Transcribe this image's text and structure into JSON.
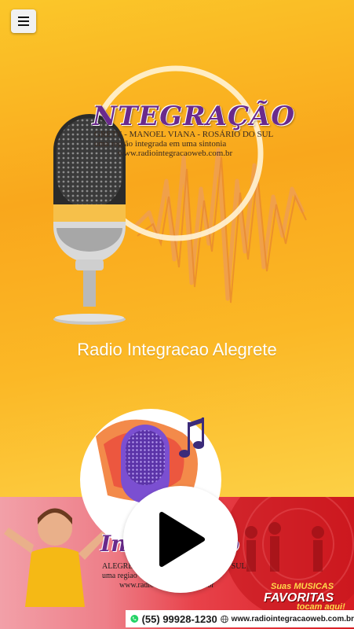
{
  "header": {
    "menu_icon": "hamburger-menu-icon"
  },
  "hero_logo": {
    "title": "NTEGRAÇÃO",
    "line1": "GRETE - MANOEL VIANA - ROSÁRIO DO SUL",
    "line2": "uma região integrada em uma sintonia",
    "line3": "www.radiointegracaoweb.com.br"
  },
  "station": {
    "name": "Radio Integracao Alegrete"
  },
  "banner": {
    "logo_title": "Int",
    "logo_title_end": "o",
    "line1": "ALEGRETE -",
    "line1_end": "O DO SUL",
    "line2": "uma regiao",
    "line2_end": "tonia",
    "line3": "www.radio",
    "line3_end": "m.br",
    "fav_line1": "Suas MUSICAS",
    "fav_line2": "FAVORITAS",
    "fav_line3": "tocam aqui!",
    "phone": "(55) 99928-1230",
    "website": "www.radiointegracaoweb.com.br"
  },
  "player": {
    "play_icon": "play-icon"
  },
  "colors": {
    "accent_purple": "#6a2a8c",
    "banner_red": "#d81c22",
    "bg_yellow": "#fbb826"
  }
}
